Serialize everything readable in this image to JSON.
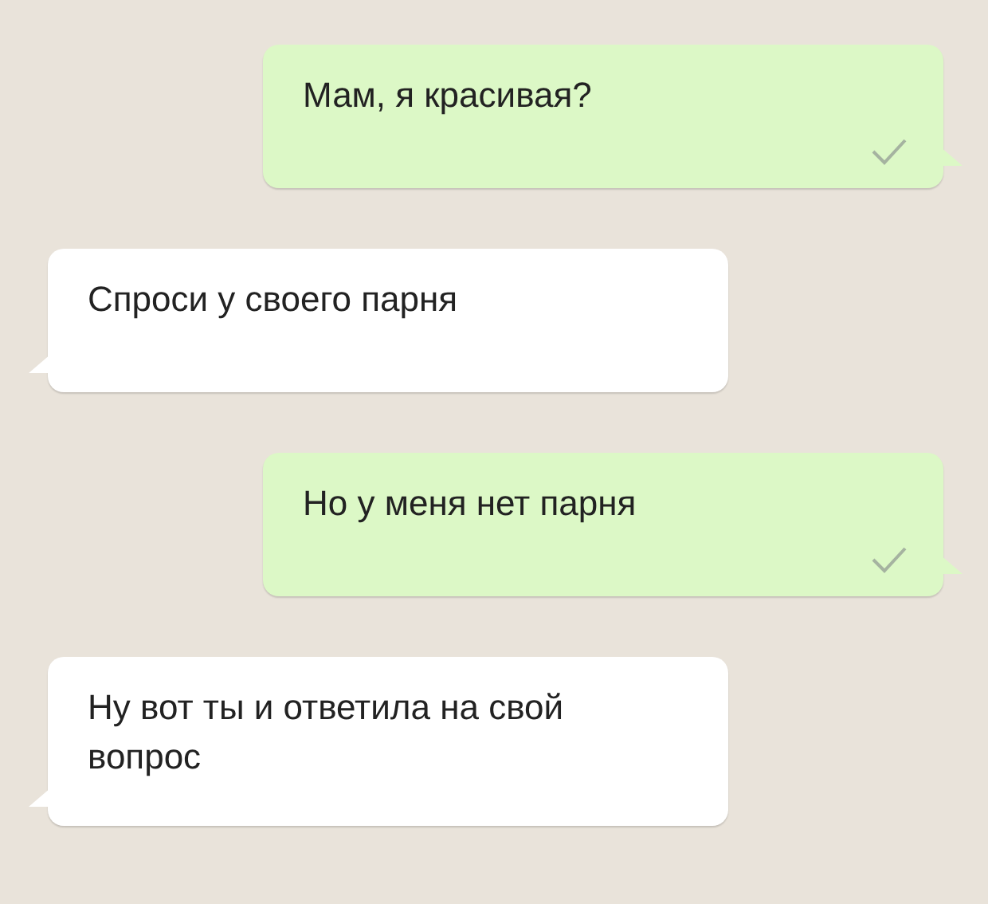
{
  "messages": [
    {
      "kind": "outgoing",
      "text": "Мам, я красивая?",
      "sent": true
    },
    {
      "kind": "incoming",
      "text": "Спроси у своего парня"
    },
    {
      "kind": "outgoing",
      "text": "Но у меня нет парня",
      "sent": true
    },
    {
      "kind": "incoming",
      "text": "Ну вот ты и ответила на свой вопрос"
    }
  ]
}
